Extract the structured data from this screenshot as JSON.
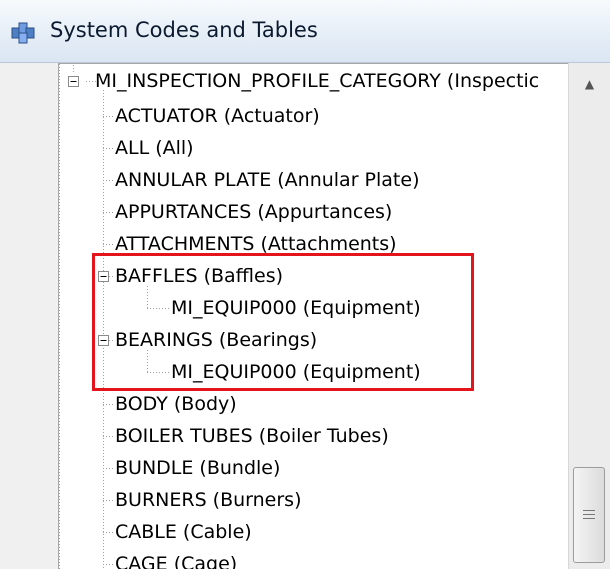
{
  "window": {
    "title": "System  Codes and Tables"
  },
  "tree": {
    "root_label": "MI_INSPECTION_PROFILE_CATEGORY (Inspectic",
    "items": [
      "ACTUATOR  (Actuator)",
      "ALL  (All)",
      "ANNULAR PLATE  (Annular Plate)",
      "APPURTANCES  (Appurtances)",
      "ATTACHMENTS  (Attachments)",
      "BAFFLES  (Baffles)",
      "MI_EQUIP000  (Equipment)",
      "BEARINGS  (Bearings)",
      "MI_EQUIP000  (Equipment)",
      "BODY  (Body)",
      "BOILER TUBES  (Boiler Tubes)",
      "BUNDLE  (Bundle)",
      "BURNERS  (Burners)",
      "CABLE  (Cable)",
      "CAGE  (Cage)"
    ]
  },
  "highlight_color": "#e3141c"
}
